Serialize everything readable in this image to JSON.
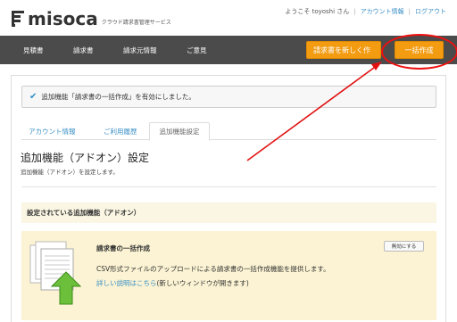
{
  "header": {
    "logo_text": "misoca",
    "logo_tagline": "クラウド請求書管理サービス",
    "welcome": "ようこそ toyoshi さん",
    "account_link": "アカウント情報",
    "logout_link": "ログアウト",
    "separator": "|"
  },
  "nav": {
    "items": [
      "見積書",
      "請求書",
      "請求元情報",
      "ご意見"
    ],
    "new_invoice_button": "請求書を新しく作",
    "bulk_create_button": "一括作成"
  },
  "alert": {
    "icon": "check-icon",
    "message": "追加機能「請求書の一括作成」を有効にしました。"
  },
  "tabs": [
    {
      "label": "アカウント情報"
    },
    {
      "label": "ご利用履歴"
    },
    {
      "label": "追加機能設定"
    }
  ],
  "page": {
    "title": "追加機能（アドオン）設定",
    "subtitle": "追加機能（アドオン）を設定します。"
  },
  "section": {
    "title": "設定されている追加機能（アドオン）"
  },
  "addon": {
    "icon": "csv-upload-icon",
    "title": "請求書の一括作成",
    "disable_button": "無効にする",
    "description": "CSV形式ファイルのアップロードによる請求書の一括作成機能を提供します。",
    "link_text": "詳しい説明はこちら",
    "link_suffix": "(新しいウィンドウが開きます)"
  },
  "colors": {
    "accent_orange": "#f39c12",
    "nav_bg": "#4b4b4b",
    "link_blue": "#3a8fc6",
    "annotation_red": "#e11111"
  }
}
